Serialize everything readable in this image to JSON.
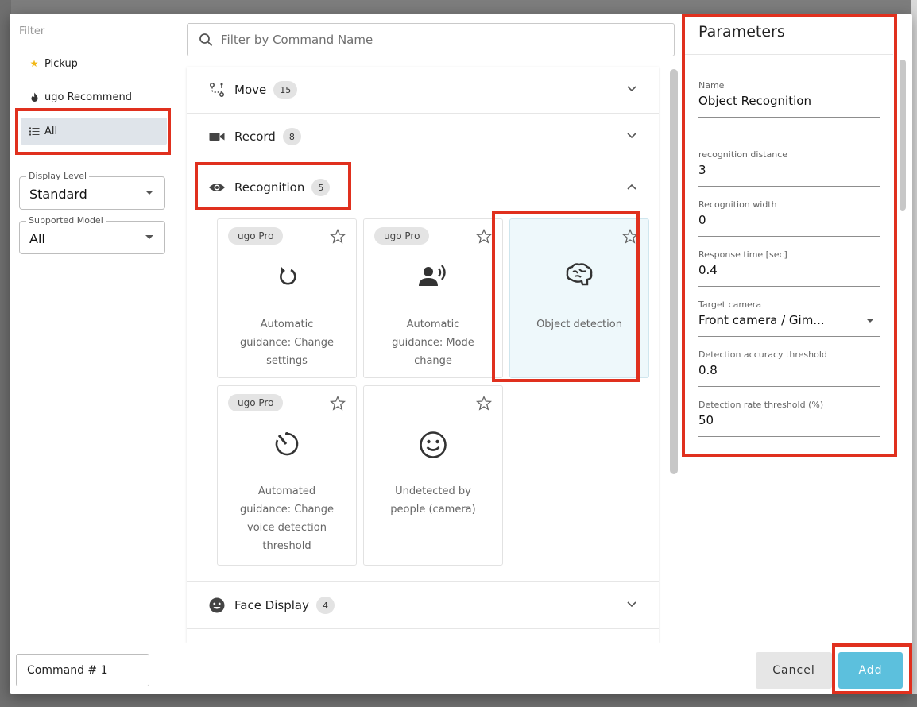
{
  "filter": {
    "heading": "Filter",
    "items": [
      {
        "label": "Pickup",
        "icon": "star-icon"
      },
      {
        "label": "ugo Recommend",
        "icon": "fire-icon"
      },
      {
        "label": "All",
        "icon": "list-icon"
      }
    ],
    "display_level": {
      "legend": "Display Level",
      "value": "Standard"
    },
    "supported_model": {
      "legend": "Supported Model",
      "value": "All"
    }
  },
  "search": {
    "placeholder": "Filter by Command Name"
  },
  "categories": [
    {
      "label": "Move",
      "count": "15",
      "icon": "route-icon",
      "expanded": false
    },
    {
      "label": "Record",
      "count": "8",
      "icon": "video-camera-icon",
      "expanded": false
    },
    {
      "label": "Recognition",
      "count": "5",
      "icon": "eye-icon",
      "expanded": true
    },
    {
      "label": "Face Display",
      "count": "4",
      "icon": "smiley-face-icon",
      "expanded": false
    }
  ],
  "cards": [
    {
      "badge": "ugo Pro",
      "icon": "rotate-icon",
      "line1": "Automatic",
      "line2": "guidance: Change",
      "line3": "settings"
    },
    {
      "badge": "ugo Pro",
      "icon": "voice-person-icon",
      "line1": "Automatic",
      "line2": "guidance: Mode",
      "line3": "change"
    },
    {
      "badge": "",
      "icon": "brain-icon",
      "line1": "Object detection",
      "selected": true
    },
    {
      "badge": "ugo Pro",
      "icon": "timer-icon",
      "line1": "Automated",
      "line2": "guidance: Change",
      "line3": "voice detection",
      "line4": "threshold"
    },
    {
      "badge": "",
      "icon": "smile-icon",
      "line1": "Undetected by",
      "line2": "people (camera)"
    }
  ],
  "params": {
    "title": "Parameters",
    "fields": [
      {
        "label": "Name",
        "value": "Object Recognition"
      },
      {
        "label": "recognition distance",
        "value": "3"
      },
      {
        "label": "Recognition width",
        "value": "0"
      },
      {
        "label": "Response time [sec]",
        "value": "0.4"
      },
      {
        "label": "Target camera",
        "value": "Front camera / Gim..."
      },
      {
        "label": "Detection accuracy threshold",
        "value": "0.8"
      },
      {
        "label": "Detection rate threshold (%)",
        "value": "50"
      }
    ]
  },
  "footer": {
    "command_name": "Command # 1",
    "cancel_label": "Cancel",
    "add_label": "Add"
  },
  "colors": {
    "accent": "#5cc0dd",
    "highlight": "#e0301e",
    "selected_card_bg": "#eef8fb"
  }
}
